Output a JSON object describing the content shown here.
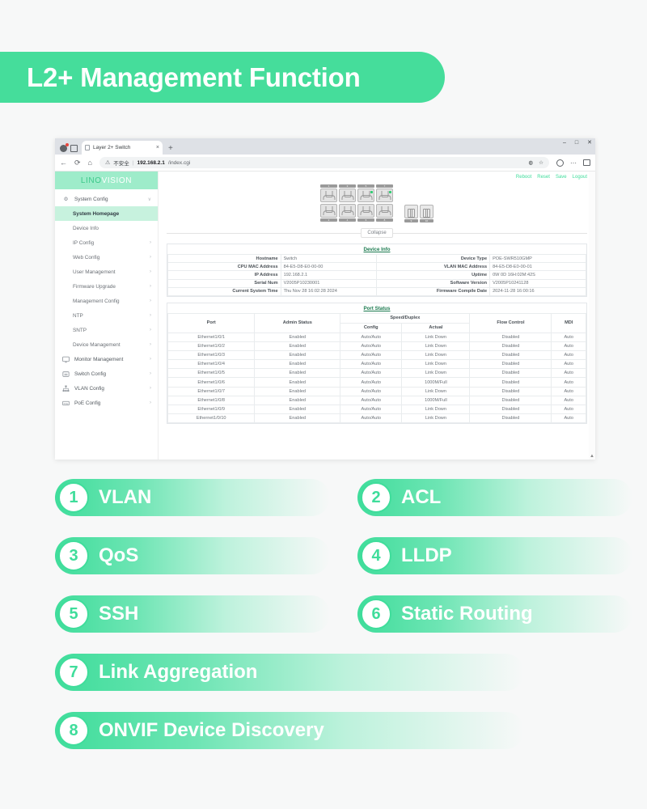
{
  "banner": {
    "title": "L2+ Management Function"
  },
  "browser": {
    "tab": {
      "label": "Layer 2+ Switch",
      "close": "×",
      "favicon": "page-icon"
    },
    "new_tab": "+",
    "window_controls": {
      "minimize": "–",
      "maximize": "□",
      "close": "✕"
    },
    "toolbar": {
      "back": "←",
      "reload": "⟳",
      "home": "⌂",
      "warning_icon": "⚠",
      "security_label": "不安全",
      "separator": "|",
      "url_host": "192.168.2.1",
      "url_path": "/index.cgi",
      "translate_icon": "translate-icon",
      "bookmark_icon": "☆",
      "profile_icon": "profile-icon",
      "menu_icon": "⋯",
      "sidebar_icon": "sidebar-icon"
    }
  },
  "app": {
    "brand": {
      "part1": "LINO",
      "part2": "VISION"
    },
    "header_links": [
      "Reboot",
      "Reset",
      "Save",
      "Logout"
    ],
    "sidebar": [
      {
        "label": "System Config",
        "icon": "gear-icon",
        "type": "group",
        "chevron": "∨"
      },
      {
        "label": "System Homepage",
        "icon": "",
        "type": "sub",
        "active": true,
        "arrow": ""
      },
      {
        "label": "Device Info",
        "icon": "",
        "type": "sub",
        "arrow": ""
      },
      {
        "label": "IP Config",
        "icon": "",
        "type": "sub",
        "arrow": "›"
      },
      {
        "label": "Web Config",
        "icon": "",
        "type": "sub",
        "arrow": "›"
      },
      {
        "label": "User Management",
        "icon": "",
        "type": "sub",
        "arrow": "›"
      },
      {
        "label": "Firmware Upgrade",
        "icon": "",
        "type": "sub",
        "arrow": "›"
      },
      {
        "label": "Management Config",
        "icon": "",
        "type": "sub",
        "arrow": "›"
      },
      {
        "label": "NTP",
        "icon": "",
        "type": "sub",
        "arrow": "›"
      },
      {
        "label": "SNTP",
        "icon": "",
        "type": "sub",
        "arrow": "›"
      },
      {
        "label": "Device Management",
        "icon": "",
        "type": "sub",
        "arrow": "›"
      },
      {
        "label": "Monitor Management",
        "icon": "monitor-icon",
        "type": "group",
        "arrow": "›"
      },
      {
        "label": "Switch Config",
        "icon": "switch-icon",
        "type": "group",
        "arrow": "›"
      },
      {
        "label": "VLAN Config",
        "icon": "vlan-icon",
        "type": "group",
        "arrow": "›"
      },
      {
        "label": "PoE Config",
        "icon": "poe-icon",
        "type": "group",
        "arrow": "›"
      }
    ],
    "panel": {
      "top_port_numbers": [
        "1",
        "3",
        "5",
        "7"
      ],
      "bottom_port_numbers": [
        "2",
        "4",
        "6",
        "8"
      ],
      "sfp_numbers": [
        "9",
        "10"
      ],
      "active_leds": [
        "5",
        "7"
      ],
      "collapse_label": "Collapse"
    },
    "device_info": {
      "title": "Device Info",
      "rows": [
        {
          "k1": "Hostname",
          "v1": "Switch",
          "k2": "Device Type",
          "v2": "POE-SWR510GMP"
        },
        {
          "k1": "CPU MAC Address",
          "v1": "84-E5-D8-E0-00-00",
          "k2": "VLAN MAC Address",
          "v2": "84-E5-D8-E0-00-01"
        },
        {
          "k1": "IP Address",
          "v1": "192.168.2.1",
          "k2": "Uptime",
          "v2": "0W 0D 16H:02M:42S"
        },
        {
          "k1": "Serial Num",
          "v1": "V2005P10230001",
          "k2": "Software Version",
          "v2": "V2005P10241128"
        },
        {
          "k1": "Current System Time",
          "v1": "Thu Nov 28 16:02:28 2024",
          "k2": "Firmware Compile Date",
          "v2": "2024-11-28 16:00:16"
        }
      ]
    },
    "port_status": {
      "title": "Port Status",
      "headers": {
        "port": "Port",
        "admin_status": "Admin Status",
        "speed_duplex": "Speed/Duplex",
        "config": "Config",
        "actual": "Actual",
        "flow_control": "Flow Control",
        "mdi": "MDI"
      },
      "rows": [
        {
          "port": "Ethernet1/0/1",
          "admin": "Enabled",
          "config": "Auto/Auto",
          "actual": "Link Down",
          "flow": "Disabled",
          "mdi": "Auto"
        },
        {
          "port": "Ethernet1/0/2",
          "admin": "Enabled",
          "config": "Auto/Auto",
          "actual": "Link Down",
          "flow": "Disabled",
          "mdi": "Auto"
        },
        {
          "port": "Ethernet1/0/3",
          "admin": "Enabled",
          "config": "Auto/Auto",
          "actual": "Link Down",
          "flow": "Disabled",
          "mdi": "Auto"
        },
        {
          "port": "Ethernet1/0/4",
          "admin": "Enabled",
          "config": "Auto/Auto",
          "actual": "Link Down",
          "flow": "Disabled",
          "mdi": "Auto"
        },
        {
          "port": "Ethernet1/0/5",
          "admin": "Enabled",
          "config": "Auto/Auto",
          "actual": "Link Down",
          "flow": "Disabled",
          "mdi": "Auto"
        },
        {
          "port": "Ethernet1/0/6",
          "admin": "Enabled",
          "config": "Auto/Auto",
          "actual": "1000M/Full",
          "flow": "Disabled",
          "mdi": "Auto"
        },
        {
          "port": "Ethernet1/0/7",
          "admin": "Enabled",
          "config": "Auto/Auto",
          "actual": "Link Down",
          "flow": "Disabled",
          "mdi": "Auto"
        },
        {
          "port": "Ethernet1/0/8",
          "admin": "Enabled",
          "config": "Auto/Auto",
          "actual": "1000M/Full",
          "flow": "Disabled",
          "mdi": "Auto"
        },
        {
          "port": "Ethernet1/0/9",
          "admin": "Enabled",
          "config": "Auto/Auto",
          "actual": "Link Down",
          "flow": "Disabled",
          "mdi": "Auto"
        },
        {
          "port": "Ethernet1/0/10",
          "admin": "Enabled",
          "config": "Auto/Auto",
          "actual": "Link Down",
          "flow": "Disabled",
          "mdi": "Auto"
        }
      ]
    }
  },
  "features": [
    {
      "num": "1",
      "label": "VLAN",
      "width": "half"
    },
    {
      "num": "2",
      "label": "ACL",
      "width": "half"
    },
    {
      "num": "3",
      "label": "QoS",
      "width": "half"
    },
    {
      "num": "4",
      "label": "LLDP",
      "width": "half"
    },
    {
      "num": "5",
      "label": "SSH",
      "width": "half"
    },
    {
      "num": "6",
      "label": "Static Routing",
      "width": "half"
    },
    {
      "num": "7",
      "label": "Link Aggregation",
      "width": "full"
    },
    {
      "num": "8",
      "label": "ONVIF Device Discovery",
      "width": "full"
    }
  ],
  "colors": {
    "brand_green": "#3fdd9b",
    "banner_green": "#45dd9b",
    "active_menu": "#c7f2de",
    "page_bg": "#f7f8f8"
  }
}
